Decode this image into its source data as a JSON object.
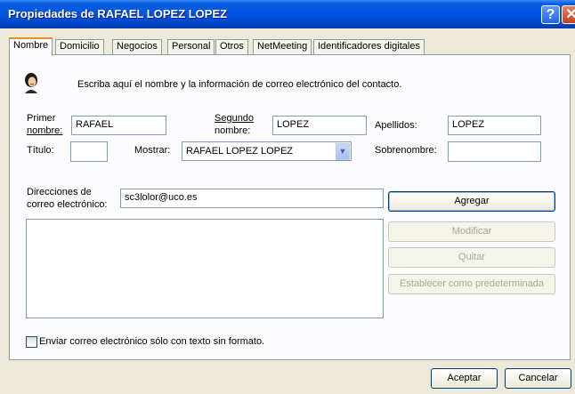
{
  "window": {
    "title": "Propiedades de RAFAEL LOPEZ LOPEZ",
    "help_glyph": "?",
    "close_glyph": "✕"
  },
  "tabs": [
    {
      "label": "Nombre",
      "active": true
    },
    {
      "label": "Domicilio"
    },
    {
      "label": "Negocios"
    },
    {
      "label": "Personal"
    },
    {
      "label": "Otros"
    },
    {
      "label": "NetMeeting"
    },
    {
      "label": "Identificadores digitales"
    }
  ],
  "intro": {
    "text": "Escriba aquí el nombre y la información de correo electrónico del contacto.",
    "icon": "contact-person-icon"
  },
  "fields": {
    "first_name": {
      "label_line1": "Primer",
      "label_line2": "nombre:",
      "value": "RAFAEL"
    },
    "middle_name": {
      "label_line1": "Segundo",
      "label_line2": "nombre:",
      "value": "LOPEZ"
    },
    "last_name": {
      "label": "Apellidos:",
      "value": "LOPEZ"
    },
    "title": {
      "label": "Título:",
      "value": ""
    },
    "display": {
      "label": "Mostrar:",
      "value": "RAFAEL LOPEZ LOPEZ"
    },
    "nickname": {
      "label": "Sobrenombre:",
      "value": ""
    }
  },
  "email": {
    "label_line1": "Direcciones de",
    "label_line2": "correo electrónico:",
    "value": "sc3lolor@uco.es",
    "addresses": []
  },
  "buttons": {
    "add": "Agregar",
    "edit": "Modificar",
    "remove": "Quitar",
    "set_default": "Establecer como predeterminada",
    "ok": "Aceptar",
    "cancel": "Cancelar"
  },
  "plain_text_checkbox": {
    "label": "Enviar correo electrónico sólo con texto sin formato.",
    "checked": false
  }
}
